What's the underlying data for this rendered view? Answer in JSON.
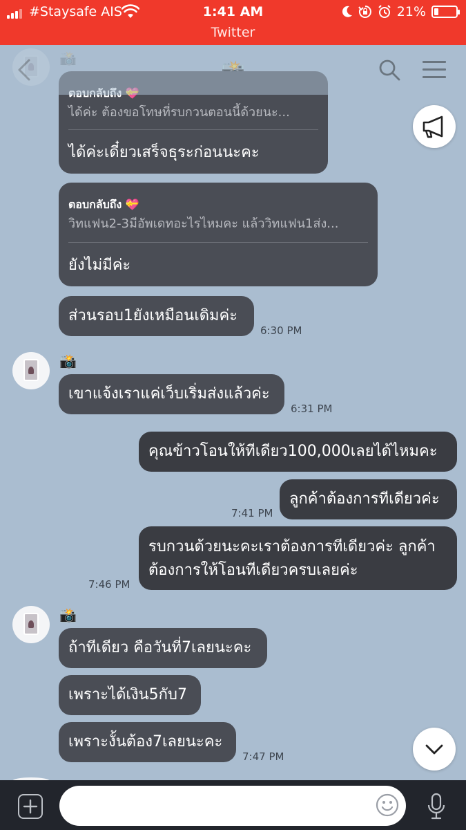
{
  "status_bar": {
    "carrier": "#Staysafe AIS",
    "time": "1:41 AM",
    "battery": "21%",
    "battery_level": 0.21,
    "back_app_label": "Twitter",
    "background_color": "#f0392b"
  },
  "nav": {
    "title": "📸",
    "back_icon": "chevron-left-icon",
    "search_icon": "search-icon",
    "menu_icon": "hamburger-menu-icon"
  },
  "messages": [
    {
      "reply_label": "ตอบกลับถึง 💝",
      "reply_quote": "ได้ค่ะ ต้องขอโทษที่รบกวนตอนนี้ด้วยนะ...",
      "text": "ได้ค่ะเดี๋ยวเสร็จธุระก่อนนะคะ"
    },
    {
      "reply_label": "ตอบกลับถึง 💝",
      "reply_quote": "วิทแฟน2-3มีอัพเดทอะไรไหมคะ แล้ววิทแฟน1ส่ง...",
      "text": "ยังไม่มีค่ะ"
    },
    {
      "text": "ส่วนรอบ1ยังเหมือนเดิมค่ะ",
      "time": "6:30 PM"
    },
    {
      "sender": "📸",
      "text": "เขาแจ้งเราแค่เว็บเริ่มส่งแล้วค่ะ",
      "time": "6:31 PM"
    },
    {
      "text": "คุณข้าวโอนให้ทีเดียว100,000เลยได้ไหมคะ"
    },
    {
      "text": "ลูกค้าต้องการทีเดียวค่ะ",
      "time": "7:41 PM"
    },
    {
      "line1": "รบกวนด้วยนะคะเราต้องการทีเดียวค่ะ ลูกค้า",
      "line2": "ต้องการให้โอนทีเดียวครบเลยค่ะ",
      "time": "7:46 PM"
    },
    {
      "sender": "📸",
      "text": "ถ้าทีเดียว คือวันที่7เลยนะคะ"
    },
    {
      "text": "เพราะได้เงิน5กับ7"
    },
    {
      "text": "เพราะงั้นต้อง7เลยนะคะ",
      "time": "7:47 PM"
    }
  ],
  "input": {
    "placeholder": "",
    "value": ""
  },
  "colors": {
    "chat_background": "#aabdd0",
    "incoming_bubble": "#4a4d55",
    "outgoing_bubble": "#3a3c42",
    "input_bar": "#22252c"
  }
}
